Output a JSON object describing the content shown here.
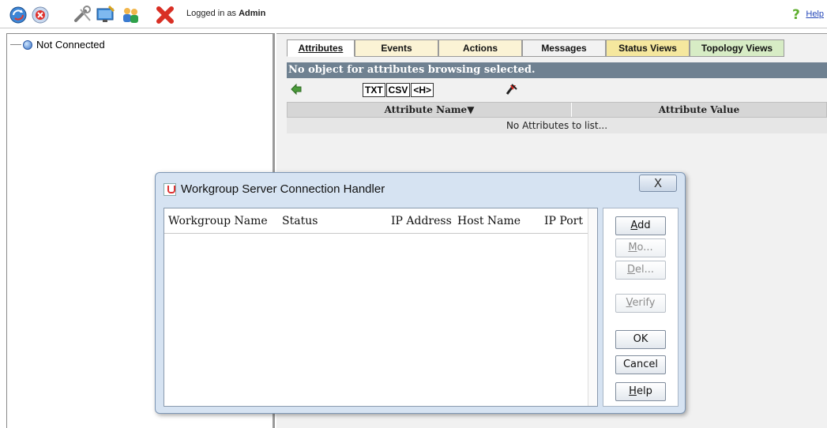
{
  "toolbar": {
    "logged_in_prefix": "Logged in as",
    "user": "Admin",
    "help_label": "Help",
    "icons": [
      "refresh-icon",
      "disconnect-icon",
      "tools-icon",
      "monitor-icon",
      "users-icon",
      "exit-icon"
    ]
  },
  "tree": {
    "items": [
      {
        "label": "Not Connected",
        "icon": "globe-icon"
      }
    ]
  },
  "tabs": [
    {
      "label": "Attributes",
      "active": true
    },
    {
      "label": "Events"
    },
    {
      "label": "Actions"
    },
    {
      "label": "Messages"
    },
    {
      "label": "Status Views"
    },
    {
      "label": "Topology Views"
    }
  ],
  "banner": "No object for attributes browsing selected.",
  "format_buttons": [
    "TXT",
    "CSV",
    "<H>"
  ],
  "attributes_table": {
    "columns": [
      "Attribute Name▼",
      "Attribute Value"
    ],
    "empty_text": "No Attributes to list..."
  },
  "dialog": {
    "title": "Workgroup Server Connection Handler",
    "close_label": "X",
    "columns": [
      "Workgroup Name",
      "Status",
      "IP Address",
      "Host Name",
      "IP Port"
    ],
    "buttons": {
      "add": {
        "mnemonic": "A",
        "rest": "dd",
        "enabled": true
      },
      "modify": {
        "mnemonic": "M",
        "rest": "o...",
        "enabled": false
      },
      "delete": {
        "mnemonic": "D",
        "rest": "el...",
        "enabled": false
      },
      "verify": {
        "mnemonic": "V",
        "rest": "erify",
        "enabled": false
      },
      "ok": {
        "label": "OK",
        "enabled": true
      },
      "cancel": {
        "label": "Cancel",
        "enabled": true
      },
      "help": {
        "mnemonic": "H",
        "rest": "elp",
        "enabled": true
      }
    }
  }
}
